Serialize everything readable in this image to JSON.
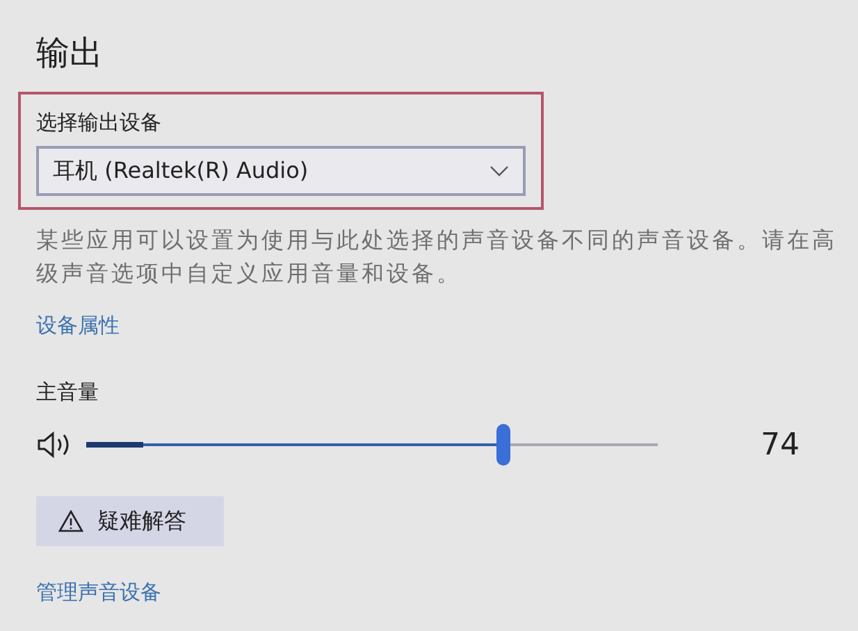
{
  "section_title": "输出",
  "device_select": {
    "label": "选择输出设备",
    "value": "耳机 (Realtek(R) Audio)",
    "highlighted": true
  },
  "description": "某些应用可以设置为使用与此处选择的声音设备不同的声音设备。请在高级声音选项中自定义应用音量和设备。",
  "device_properties_link": "设备属性",
  "master_volume": {
    "label": "主音量",
    "level": 0.73,
    "meter": {
      "level": 0.1
    },
    "reading": "74"
  },
  "troubleshoot_button": "疑难解答",
  "manage_devices_link": "管理声音设备"
}
